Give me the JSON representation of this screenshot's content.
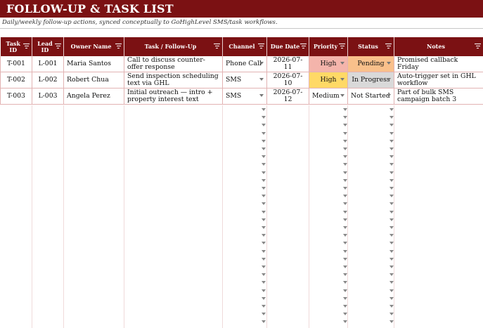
{
  "sheet": {
    "title": "FOLLOW-UP & TASK LIST",
    "subtitle": "Daily/weekly follow-up actions, synced conceptually to GoHighLevel SMS/task workflows."
  },
  "headers": [
    {
      "name": "task-id",
      "label": "Task ID"
    },
    {
      "name": "lead-id",
      "label": "Lead ID"
    },
    {
      "name": "owner-name",
      "label": "Owner Name"
    },
    {
      "name": "task-follow-up",
      "label": "Task / Follow-Up"
    },
    {
      "name": "channel",
      "label": "Channel"
    },
    {
      "name": "due-date",
      "label": "Due Date"
    },
    {
      "name": "priority",
      "label": "Priority"
    },
    {
      "name": "status",
      "label": "Status"
    },
    {
      "name": "notes",
      "label": "Notes"
    }
  ],
  "rows": [
    {
      "task_id": "T-001",
      "lead_id": "L-001",
      "owner": "Maria Santos",
      "task": "Call to discuss counter-offer response",
      "channel": "Phone Call",
      "due": "2026-07-11",
      "priority": "High",
      "status": "Pending",
      "notes": "Promised callback Friday"
    },
    {
      "task_id": "T-002",
      "lead_id": "L-002",
      "owner": "Robert Chua",
      "task": "Send inspection scheduling text via GHL",
      "channel": "SMS",
      "due": "2026-07-10",
      "priority": "High",
      "status": "In Progress",
      "notes": "Auto-trigger set in GHL workflow"
    },
    {
      "task_id": "T-003",
      "lead_id": "L-003",
      "owner": "Angela Perez",
      "task": "Initial outreach — intro + property interest text",
      "channel": "SMS",
      "due": "2026-07-12",
      "priority": "Medium",
      "status": "Not Started",
      "notes": "Part of bulk SMS campaign batch 3"
    }
  ],
  "colors": {
    "header_bg": "#7b1113",
    "priority_high_red": "#f4b4ab",
    "priority_high_yellow": "#ffd966",
    "status_pending": "#f9c08b",
    "status_in_progress": "#d9d9d9"
  },
  "icons": {
    "filter": "filter-icon",
    "dropdown": "dropdown-caret-icon"
  }
}
